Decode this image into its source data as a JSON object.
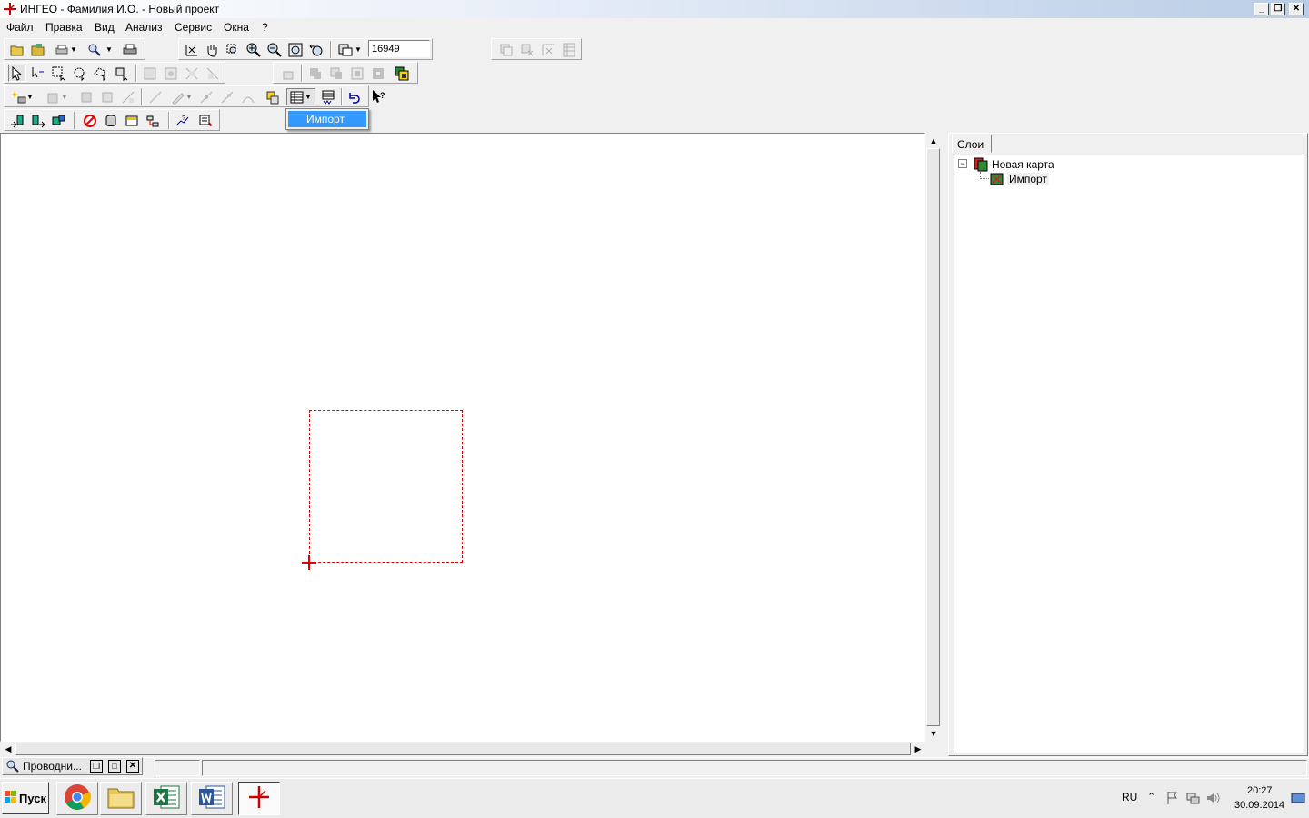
{
  "window": {
    "title": "ИНГЕО - Фамилия И.О. - Новый проект"
  },
  "menu": [
    "Файл",
    "Правка",
    "Вид",
    "Анализ",
    "Сервис",
    "Окна",
    "?"
  ],
  "toolbar": {
    "scale_value": "16949"
  },
  "dropdown": {
    "item": "Импорт"
  },
  "layers_panel": {
    "tab": "Слои",
    "tree": {
      "root": "Новая карта",
      "child": "Импорт",
      "root_expander": "⊟"
    }
  },
  "statusbar": {
    "explorer_task": "Проводни..."
  },
  "taskbar": {
    "start_label": "Пуск",
    "language": "RU",
    "time": "20:27",
    "date": "30.09.2014"
  },
  "colors": {
    "selection": "#e00000",
    "accent": "#3399ff"
  }
}
